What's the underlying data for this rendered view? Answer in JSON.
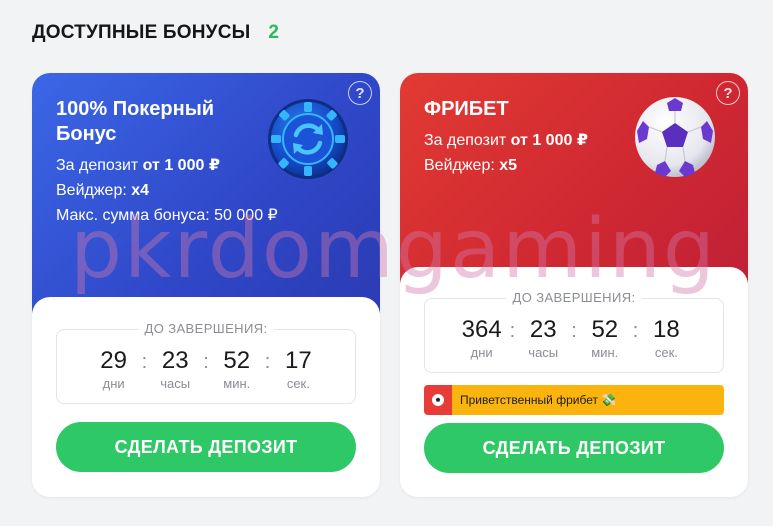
{
  "header": {
    "title": "ДОСТУПНЫЕ БОНУСЫ",
    "count": "2"
  },
  "cards": [
    {
      "title": "100% Покерный Бонус",
      "lines": [
        {
          "prefix": "За депозит ",
          "bold": "от 1 000 ₽"
        },
        {
          "prefix": "Вейджер: ",
          "bold": "x4"
        },
        {
          "prefix": "Макс. сумма бонуса: 50 000 ₽",
          "bold": ""
        }
      ],
      "help": "?",
      "icon": "poker-chip-icon",
      "timer": {
        "label": "ДО ЗАВЕРШЕНИЯ:",
        "days": "29",
        "days_label": "дни",
        "hours": "23",
        "hours_label": "часы",
        "minutes": "52",
        "minutes_label": "мин.",
        "seconds": "17",
        "seconds_label": "сек."
      },
      "cta": "СДЕЛАТЬ ДЕПОЗИТ"
    },
    {
      "title": "ФРИБЕТ",
      "lines": [
        {
          "prefix": "За депозит ",
          "bold": "от 1 000 ₽"
        },
        {
          "prefix": "Вейджер: ",
          "bold": "x5"
        }
      ],
      "help": "?",
      "icon": "soccer-ball-icon",
      "timer": {
        "label": "ДО ЗАВЕРШЕНИЯ:",
        "days": "364",
        "days_label": "дни",
        "hours": "23",
        "hours_label": "часы",
        "minutes": "52",
        "minutes_label": "мин.",
        "seconds": "18",
        "seconds_label": "сек."
      },
      "tag": "Приветственный фрибет 💸",
      "cta": "СДЕЛАТЬ ДЕПОЗИТ"
    }
  ],
  "watermark": "pkrdomgaming",
  "colors": {
    "poker_blue": "#3356d8",
    "freebet_red": "#d42d33",
    "cta_green": "#2fc866",
    "count_green": "#2bb95b",
    "tag_yellow": "#fbb40e"
  }
}
